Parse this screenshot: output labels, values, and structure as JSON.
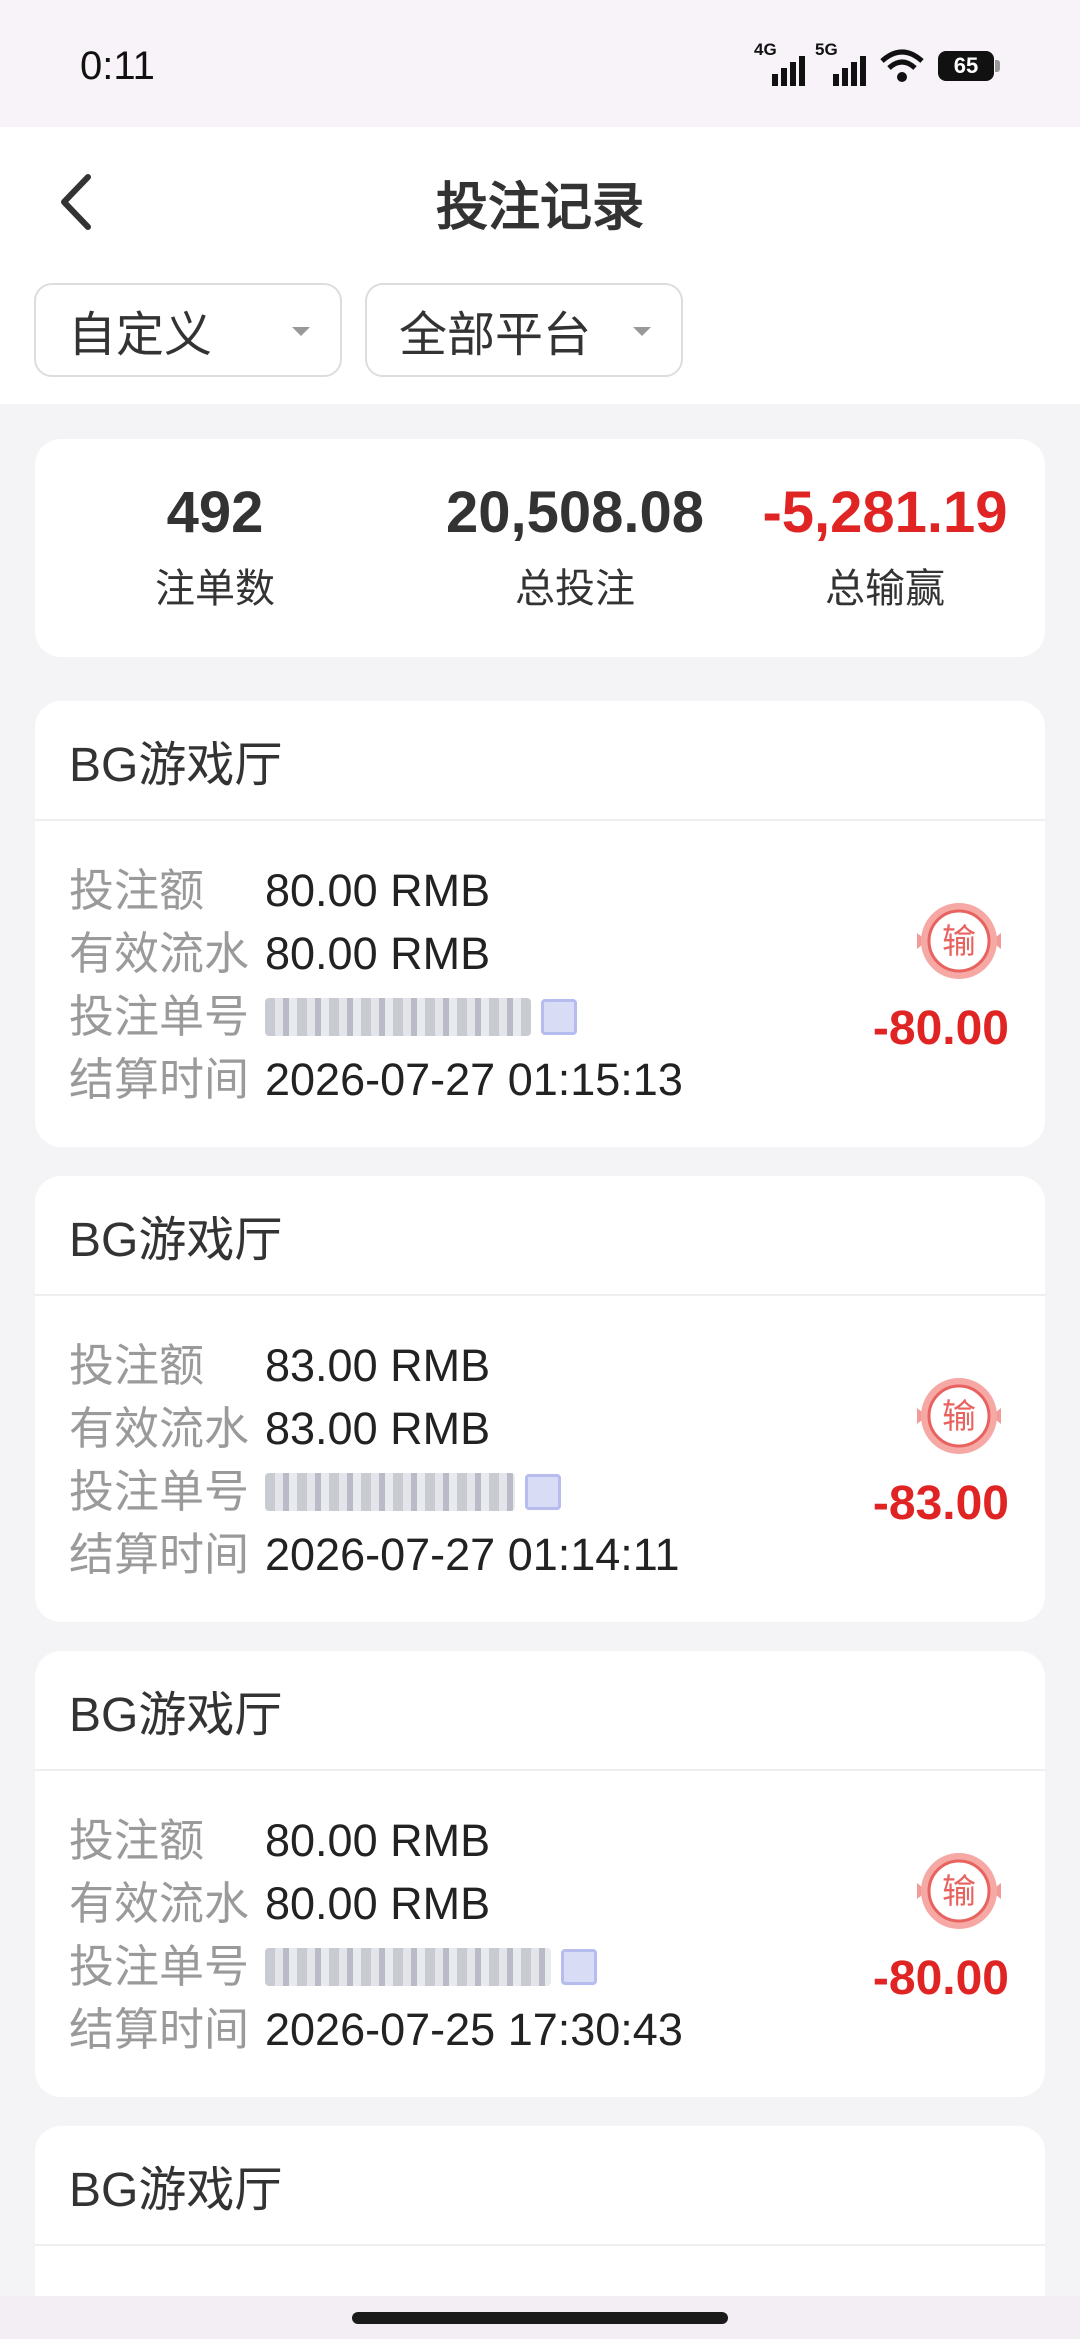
{
  "status_bar": {
    "time": "0:11",
    "net1": "4G",
    "net2": "5G",
    "battery": "65"
  },
  "header": {
    "title": "投注记录",
    "filter_date": "自定义",
    "filter_platform": "全部平台"
  },
  "summary": {
    "count_value": "492",
    "count_label": "注单数",
    "bet_value": "20,508.08",
    "bet_label": "总投注",
    "winloss_value": "-5,281.19",
    "winloss_label": "总输赢"
  },
  "labels": {
    "amount": "投注额",
    "valid": "有效流水",
    "order": "投注单号",
    "time": "结算时间",
    "lose": "输"
  },
  "colors": {
    "loss": "#e02424",
    "accent": "#e8625f"
  },
  "records": [
    {
      "hall": "BG游戏厅",
      "amount": "80.00 RMB",
      "valid": "80.00 RMB",
      "time": "2026-07-27 01:15:13",
      "result": "-80.00"
    },
    {
      "hall": "BG游戏厅",
      "amount": "83.00 RMB",
      "valid": "83.00 RMB",
      "time": "2026-07-27 01:14:11",
      "result": "-83.00"
    },
    {
      "hall": "BG游戏厅",
      "amount": "80.00 RMB",
      "valid": "80.00 RMB",
      "time": "2026-07-25 17:30:43",
      "result": "-80.00"
    },
    {
      "hall": "BG游戏厅"
    }
  ]
}
